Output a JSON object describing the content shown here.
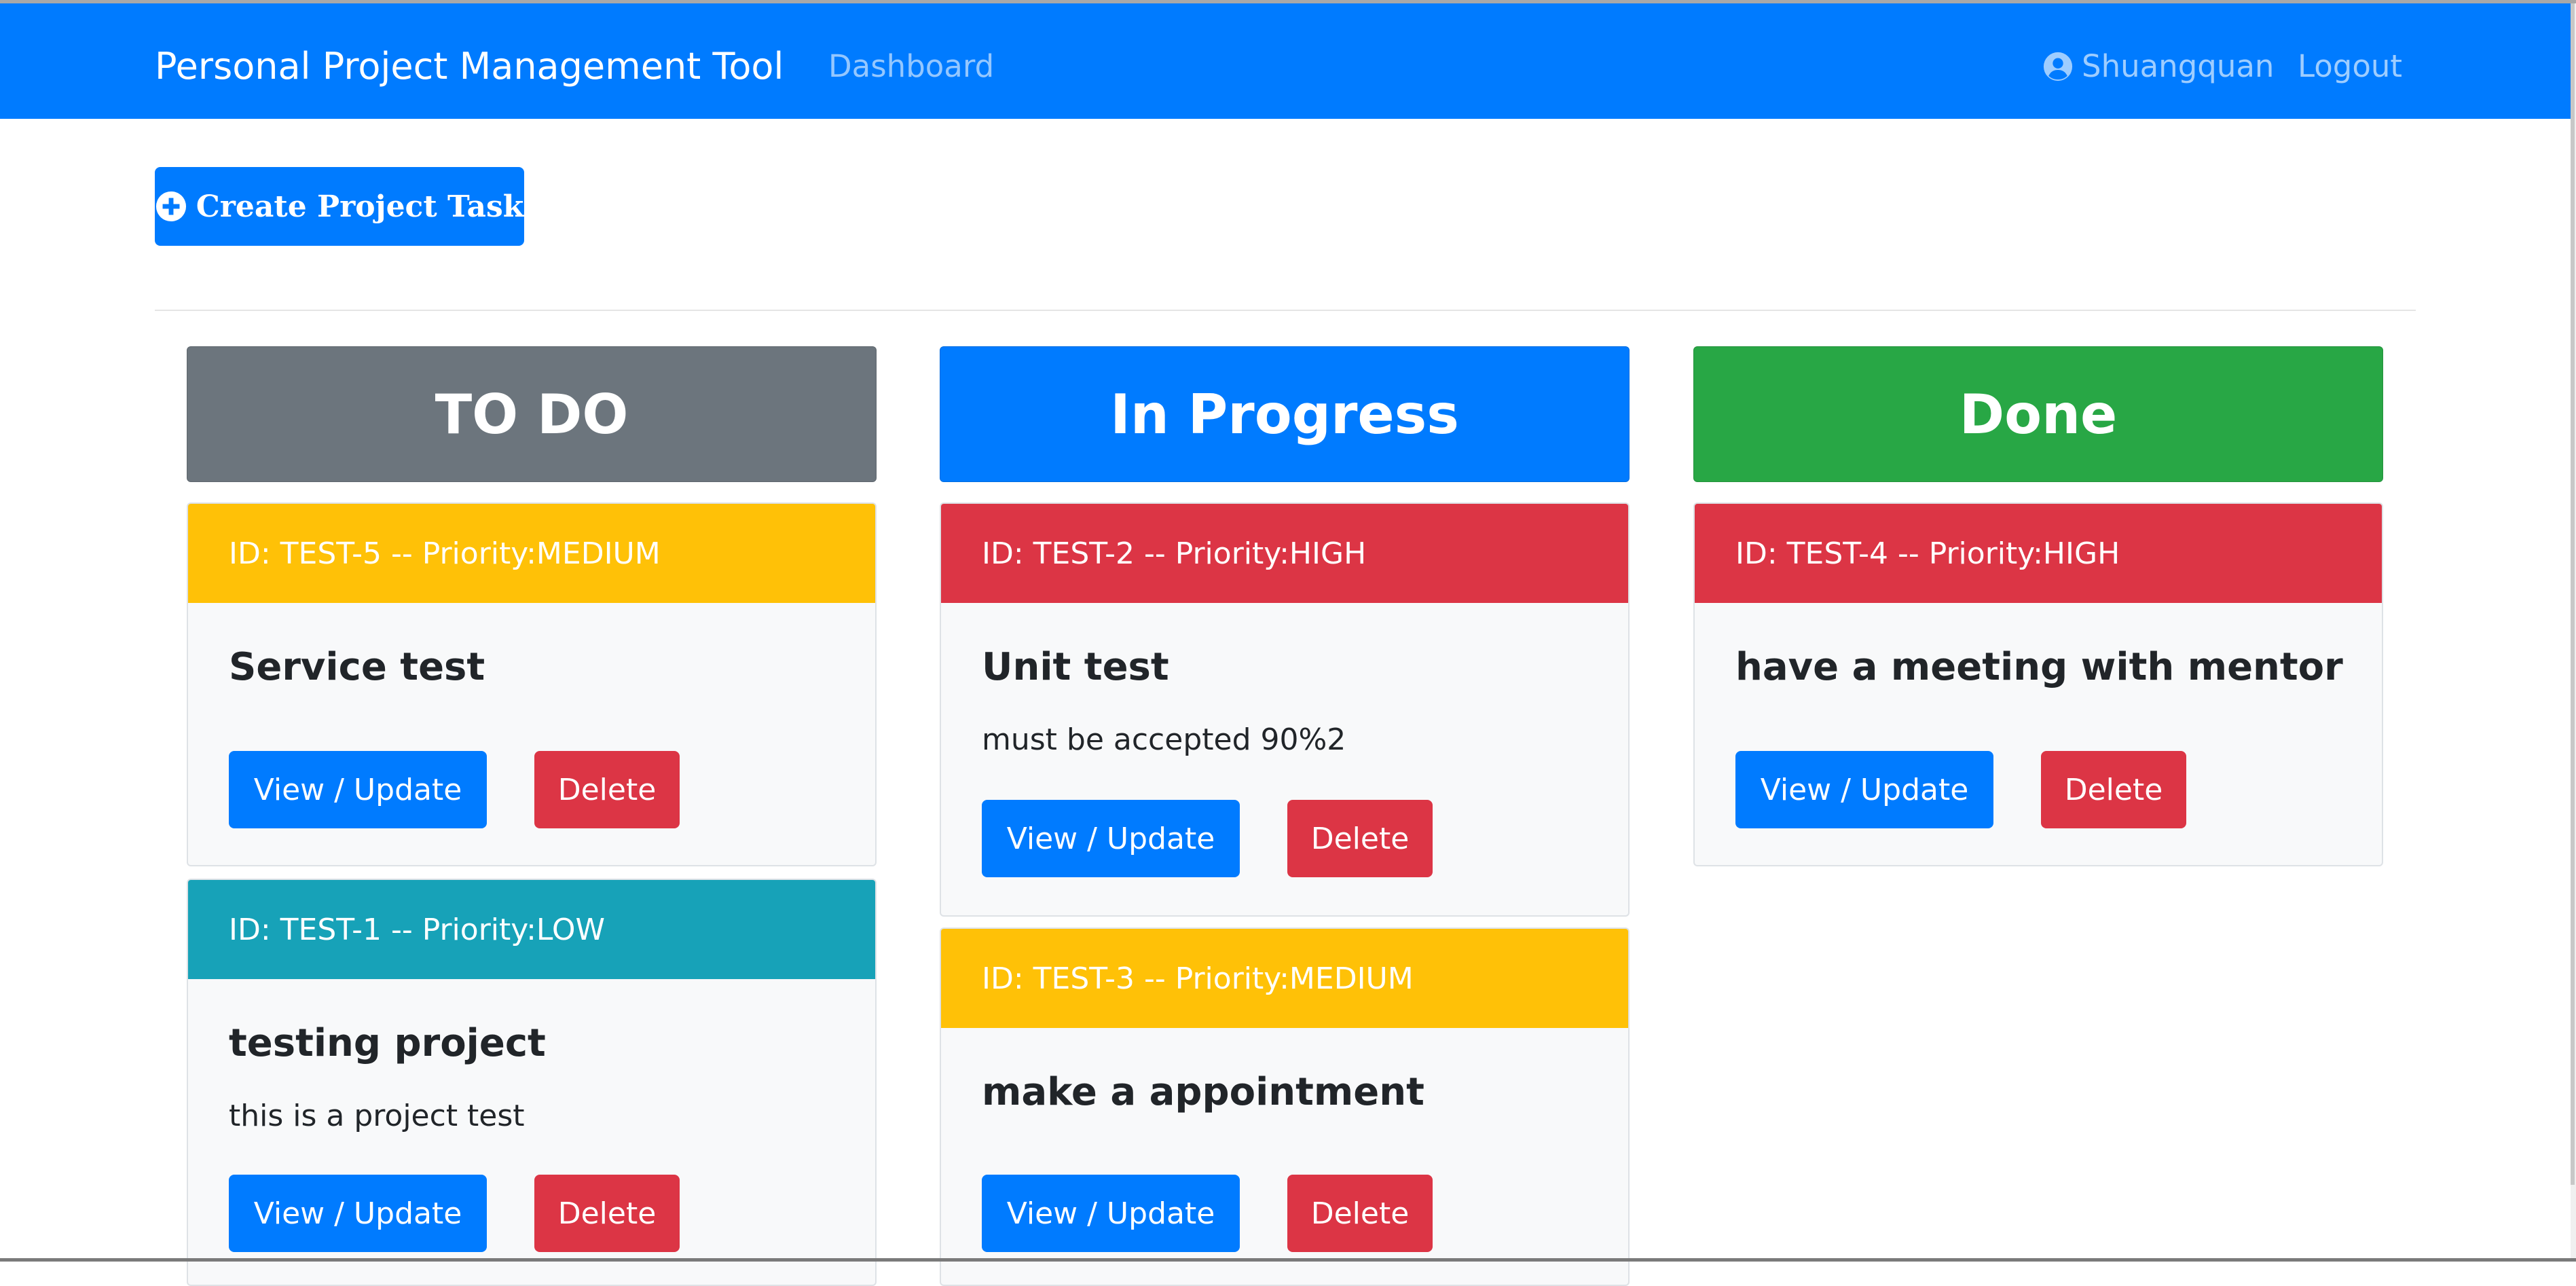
{
  "navbar": {
    "brand": "Personal Project Management Tool",
    "dashboard": "Dashboard",
    "user": "Shuangquan",
    "logout": "Logout",
    "user_icon": "user-circle-icon"
  },
  "toolbar": {
    "create_label": "Create Project Task",
    "create_icon": "plus-circle-icon"
  },
  "colors": {
    "primary": "#007bff",
    "secondary": "#6c757d",
    "success": "#28a745",
    "danger": "#dc3545",
    "warning": "#ffc107",
    "info": "#17a2b8"
  },
  "board": {
    "todo": {
      "title": "TO DO",
      "cards": [
        {
          "header": "ID: TEST-5 -- Priority:MEDIUM",
          "title": "Service test",
          "description": "",
          "view_label": "View / Update",
          "delete_label": "Delete"
        },
        {
          "header": "ID: TEST-1 -- Priority:LOW",
          "title": "testing project",
          "description": "this is a project test",
          "view_label": "View / Update",
          "delete_label": "Delete"
        }
      ]
    },
    "in_progress": {
      "title": "In Progress",
      "cards": [
        {
          "header": "ID: TEST-2 -- Priority:HIGH",
          "title": "Unit test",
          "description": "must be accepted 90%2",
          "view_label": "View / Update",
          "delete_label": "Delete"
        },
        {
          "header": "ID: TEST-3 -- Priority:MEDIUM",
          "title": "make a appointment",
          "description": "",
          "view_label": "View / Update",
          "delete_label": "Delete"
        }
      ]
    },
    "done": {
      "title": "Done",
      "cards": [
        {
          "header": "ID: TEST-4 -- Priority:HIGH",
          "title": "have a meeting with mentor",
          "description": "",
          "view_label": "View / Update",
          "delete_label": "Delete"
        }
      ]
    }
  }
}
